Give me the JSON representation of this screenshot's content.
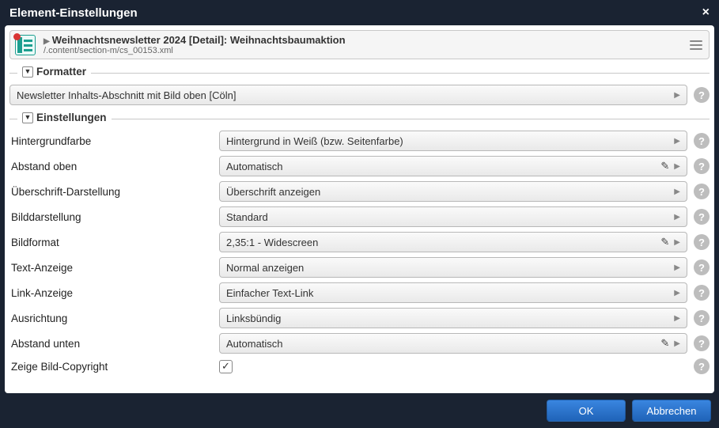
{
  "dialog": {
    "title": "Element-Einstellungen"
  },
  "resource": {
    "title": "Weihnachtsnewsletter 2024 [Detail]: Weihnachtsbaumaktion",
    "path": "/.content/section-m/cs_00153.xml"
  },
  "sections": {
    "formatter": {
      "title": "Formatter",
      "value": "Newsletter Inhalts-Abschnitt mit Bild oben [Cöln]"
    },
    "settings": {
      "title": "Einstellungen",
      "fields": [
        {
          "label": "Hintergrundfarbe",
          "value": "Hintergrund in Weiß (bzw. Seitenfarbe)",
          "editable": false
        },
        {
          "label": "Abstand oben",
          "value": "Automatisch",
          "editable": true
        },
        {
          "label": "Überschrift-Darstellung",
          "value": "Überschrift anzeigen",
          "editable": false
        },
        {
          "label": "Bilddarstellung",
          "value": "Standard",
          "editable": false
        },
        {
          "label": "Bildformat",
          "value": "2,35:1 - Widescreen",
          "editable": true
        },
        {
          "label": "Text-Anzeige",
          "value": "Normal anzeigen",
          "editable": false
        },
        {
          "label": "Link-Anzeige",
          "value": "Einfacher Text-Link",
          "editable": false
        },
        {
          "label": "Ausrichtung",
          "value": "Linksbündig",
          "editable": false
        },
        {
          "label": "Abstand unten",
          "value": "Automatisch",
          "editable": true
        }
      ],
      "copyright": {
        "label": "Zeige Bild-Copyright",
        "checked": true
      }
    }
  },
  "buttons": {
    "ok": "OK",
    "cancel": "Abbrechen"
  }
}
